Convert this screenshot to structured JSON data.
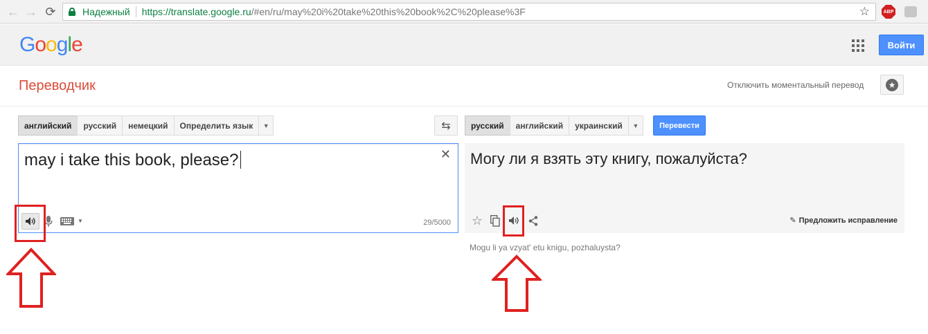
{
  "browser": {
    "back": "←",
    "forward": "→",
    "reload": "⟳",
    "secure_label": "Надежный",
    "url_host": "https://translate.google.ru",
    "url_rest": "/#en/ru/may%20i%20take%20this%20book%2C%20please%3F",
    "abp_label": "ABP"
  },
  "google_bar": {
    "logo_letters": [
      "G",
      "o",
      "o",
      "g",
      "l",
      "e"
    ],
    "signin_label": "Войти"
  },
  "header": {
    "title": "Переводчик",
    "instant_toggle": "Отключить моментальный перевод"
  },
  "source_langs": {
    "items": [
      "английский",
      "русский",
      "немецкий",
      "Определить язык"
    ],
    "selected": "английский"
  },
  "target_langs": {
    "items": [
      "русский",
      "английский",
      "украинский"
    ],
    "selected": "русский"
  },
  "translate_label": "Перевести",
  "source": {
    "text": "may i take this book, please?",
    "char_count": "29/5000"
  },
  "result": {
    "text": "Могу ли я взять эту книгу, пожалуйста?",
    "suggest_label": "Предложить исправление",
    "transliteration": "Mogu li ya vzyat' etu knigu, pozhaluysta?"
  },
  "annotation_color": "#e02020"
}
